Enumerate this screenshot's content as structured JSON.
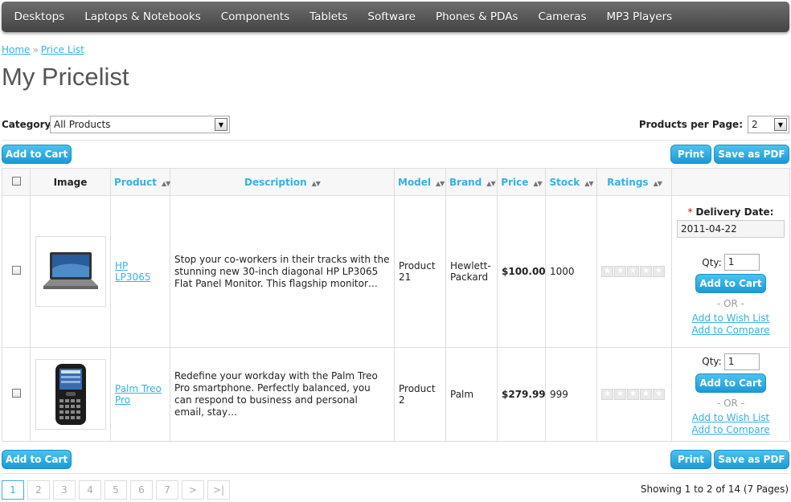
{
  "nav": {
    "items": [
      "Desktops",
      "Laptops & Notebooks",
      "Components",
      "Tablets",
      "Software",
      "Phones & PDAs",
      "Cameras",
      "MP3 Players"
    ]
  },
  "breadcrumb": {
    "home": "Home",
    "separator": "»",
    "current": "Price List"
  },
  "page_title": "My Pricelist",
  "filters": {
    "category_label": "Category:",
    "category_value": "All Products",
    "per_page_label": "Products per Page:",
    "per_page_value": "2"
  },
  "actions": {
    "add_to_cart": "Add to Cart",
    "print": "Print",
    "save_pdf": "Save as PDF"
  },
  "table": {
    "headers": {
      "image": "Image",
      "product": "Product",
      "description": "Description",
      "model": "Model",
      "brand": "Brand",
      "price": "Price",
      "stock": "Stock",
      "ratings": "Ratings"
    },
    "delivery_label": "Delivery Date:",
    "required_mark": "*",
    "qty_label": "Qty:",
    "or_label": "- OR -",
    "wish_label": "Add to Wish List",
    "compare_label": "Add to Compare",
    "rows": [
      {
        "product": "HP LP3065",
        "description": "Stop your co-workers in their tracks with the stunning new 30-inch diagonal HP LP3065 Flat Panel Monitor. This flagship monitor…",
        "model": "Product 21",
        "brand": "Hewlett-Packard",
        "price": "$100.00",
        "stock": "1000",
        "rating": 0,
        "delivery_date": "2011-04-22",
        "qty": "1",
        "image_icon": "laptop-icon"
      },
      {
        "product": "Palm Treo Pro",
        "description": "Redefine your workday with the Palm Treo Pro smartphone. Perfectly balanced, you can respond to business and personal email, stay…",
        "model": "Product 2",
        "brand": "Palm",
        "price": "$279.99",
        "stock": "999",
        "rating": 0,
        "qty": "1",
        "image_icon": "smartphone-icon"
      }
    ]
  },
  "pagination": {
    "pages": [
      "1",
      "2",
      "3",
      "4",
      "5",
      "6",
      "7"
    ],
    "active": "1",
    "next": ">",
    "last": ">|",
    "summary": "Showing 1 to 2 of 14 (7 Pages)"
  },
  "colors": {
    "accent": "#38B0E3",
    "button": "#1a9ad6",
    "nav_bg": "#555555"
  }
}
